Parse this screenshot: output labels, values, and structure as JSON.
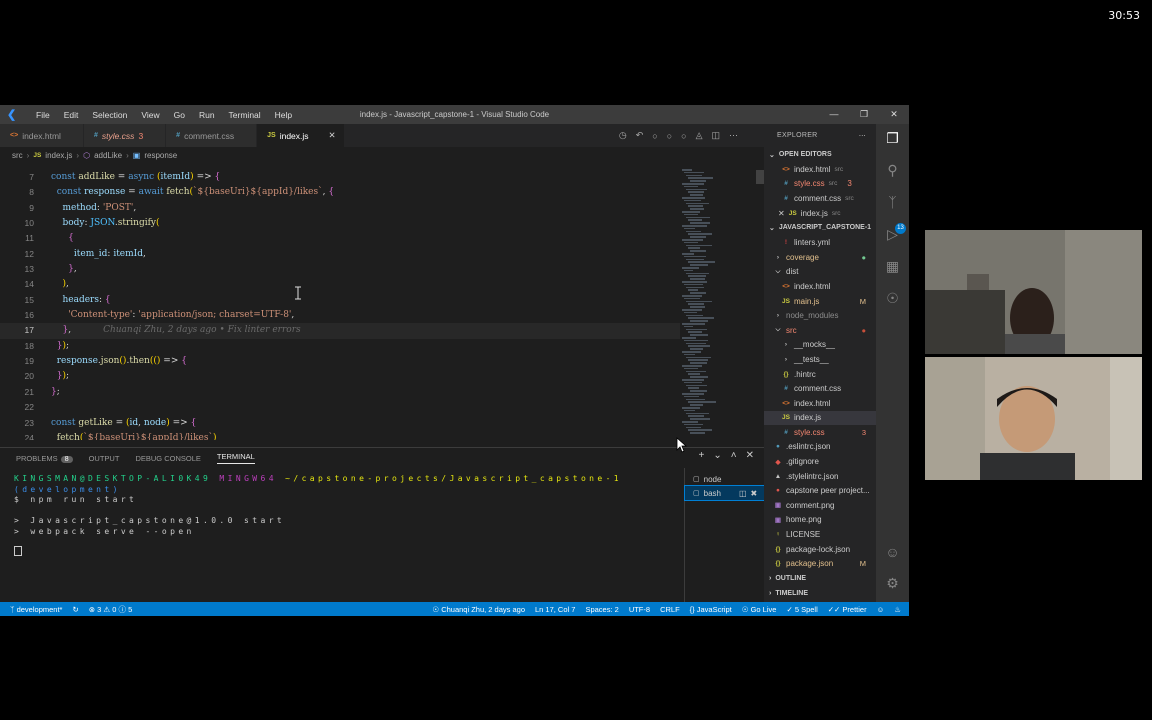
{
  "timer": "30:53",
  "window": {
    "title": "index.js - Javascript_capstone-1 - Visual Studio Code",
    "menu": [
      "File",
      "Edit",
      "Selection",
      "View",
      "Go",
      "Run",
      "Terminal",
      "Help"
    ]
  },
  "tabs": [
    {
      "icon": "<>",
      "label": "index.html",
      "badge": "",
      "type": "html"
    },
    {
      "icon": "#",
      "label": "style.css",
      "badge": "3",
      "type": "css"
    },
    {
      "icon": "#",
      "label": "comment.css",
      "badge": "",
      "type": "css"
    },
    {
      "icon": "JS",
      "label": "index.js",
      "badge": "",
      "type": "js"
    }
  ],
  "breadcrumb": [
    "src",
    "index.js",
    "addLike",
    "response"
  ],
  "code": {
    "current_line": 17,
    "blame": "Chuanqi Zhu, 2 days ago • Fix linter errors",
    "lines": [
      {
        "n": 7,
        "text": "const addLike = async (itemId) => {"
      },
      {
        "n": 8,
        "text": "  const response = await fetch(`${baseUri}${appId}/likes`, {"
      },
      {
        "n": 9,
        "text": "    method: 'POST',"
      },
      {
        "n": 10,
        "text": "    body: JSON.stringify("
      },
      {
        "n": 11,
        "text": "      {"
      },
      {
        "n": 12,
        "text": "        item_id: itemId,"
      },
      {
        "n": 13,
        "text": "      },"
      },
      {
        "n": 14,
        "text": "    ),"
      },
      {
        "n": 15,
        "text": "    headers: {"
      },
      {
        "n": 16,
        "text": "      'Content-type': 'application/json; charset=UTF-8',"
      },
      {
        "n": 17,
        "text": "    },"
      },
      {
        "n": 18,
        "text": "  });"
      },
      {
        "n": 19,
        "text": "  response.json().then(() => {"
      },
      {
        "n": 20,
        "text": "  });"
      },
      {
        "n": 21,
        "text": "};"
      },
      {
        "n": 22,
        "text": ""
      },
      {
        "n": 23,
        "text": "const getLike = (id, node) => {"
      },
      {
        "n": 24,
        "text": "  fetch(`${baseUri}${appId}/likes`)"
      }
    ]
  },
  "panel": {
    "tabs": [
      {
        "label": "PROBLEMS",
        "badge": "8"
      },
      {
        "label": "OUTPUT",
        "badge": ""
      },
      {
        "label": "DEBUG CONSOLE",
        "badge": ""
      },
      {
        "label": "TERMINAL",
        "badge": ""
      }
    ],
    "prompt_user": "KINGSMAN@DESKTOP-ALI0K49",
    "prompt_env": "MINGW64",
    "prompt_path": "~/capstone-projects/Javascript_capstone-1",
    "prompt_branch": "(development)",
    "command": "$ npm run start",
    "output1": "> Javascript_capstone@1.0.0 start",
    "output2": "> webpack serve --open",
    "terminals": [
      {
        "label": "node",
        "selected": false
      },
      {
        "label": "bash",
        "selected": true
      }
    ]
  },
  "explorer": {
    "title": "EXPLORER",
    "open_editors_label": "OPEN EDITORS",
    "open_editors": [
      {
        "name": "index.html",
        "desc": "src",
        "badge": "",
        "type": "html"
      },
      {
        "name": "style.css",
        "desc": "src",
        "badge": "3",
        "type": "css"
      },
      {
        "name": "comment.css",
        "desc": "src",
        "badge": "",
        "type": "css"
      },
      {
        "name": "index.js",
        "desc": "src",
        "badge": "",
        "type": "js"
      }
    ],
    "project_label": "JAVASCRIPT_CAPSTONE-1",
    "tree": [
      {
        "name": "linters.yml",
        "indent": 2,
        "kind": "yml",
        "status": ""
      },
      {
        "name": "coverage",
        "indent": 1,
        "kind": "folder-closed",
        "status": "dot"
      },
      {
        "name": "dist",
        "indent": 1,
        "kind": "folder-open",
        "status": ""
      },
      {
        "name": "index.html",
        "indent": 2,
        "kind": "html",
        "status": ""
      },
      {
        "name": "main.js",
        "indent": 2,
        "kind": "js",
        "status": "M"
      },
      {
        "name": "node_modules",
        "indent": 1,
        "kind": "folder-closed-dim",
        "status": ""
      },
      {
        "name": "src",
        "indent": 1,
        "kind": "folder-open",
        "status": "dot-red"
      },
      {
        "name": "__mocks__",
        "indent": 2,
        "kind": "folder-closed",
        "status": ""
      },
      {
        "name": "__tests__",
        "indent": 2,
        "kind": "folder-closed",
        "status": ""
      },
      {
        "name": ".hintrc",
        "indent": 2,
        "kind": "json",
        "status": ""
      },
      {
        "name": "comment.css",
        "indent": 2,
        "kind": "css",
        "status": ""
      },
      {
        "name": "index.html",
        "indent": 2,
        "kind": "html",
        "status": ""
      },
      {
        "name": "index.js",
        "indent": 2,
        "kind": "js",
        "status": "",
        "selected": true
      },
      {
        "name": "style.css",
        "indent": 2,
        "kind": "css",
        "status": "3"
      },
      {
        "name": ".eslintrc.json",
        "indent": 1,
        "kind": "eslint",
        "status": ""
      },
      {
        "name": ".gitignore",
        "indent": 1,
        "kind": "git",
        "status": ""
      },
      {
        "name": ".stylelintrc.json",
        "indent": 1,
        "kind": "stylelint",
        "status": ""
      },
      {
        "name": "capstone peer project...",
        "indent": 1,
        "kind": "md",
        "status": ""
      },
      {
        "name": "comment.png",
        "indent": 1,
        "kind": "png",
        "status": ""
      },
      {
        "name": "home.png",
        "indent": 1,
        "kind": "png",
        "status": ""
      },
      {
        "name": "LICENSE",
        "indent": 1,
        "kind": "lic",
        "status": ""
      },
      {
        "name": "package-lock.json",
        "indent": 1,
        "kind": "json",
        "status": ""
      },
      {
        "name": "package.json",
        "indent": 1,
        "kind": "json",
        "status": "M"
      }
    ],
    "outline_label": "OUTLINE",
    "timeline_label": "TIMELINE"
  },
  "activity_badge": "13",
  "statusbar": {
    "branch": "development*",
    "errors": "3",
    "warnings": "0",
    "infos": "5",
    "blame": "Chuanqi Zhu, 2 days ago",
    "position": "Ln 17, Col 7",
    "spaces": "Spaces: 2",
    "encoding": "UTF-8",
    "eol": "CRLF",
    "language": "JavaScript",
    "golive": "Go Live",
    "spell": "5 Spell",
    "prettier": "Prettier"
  }
}
